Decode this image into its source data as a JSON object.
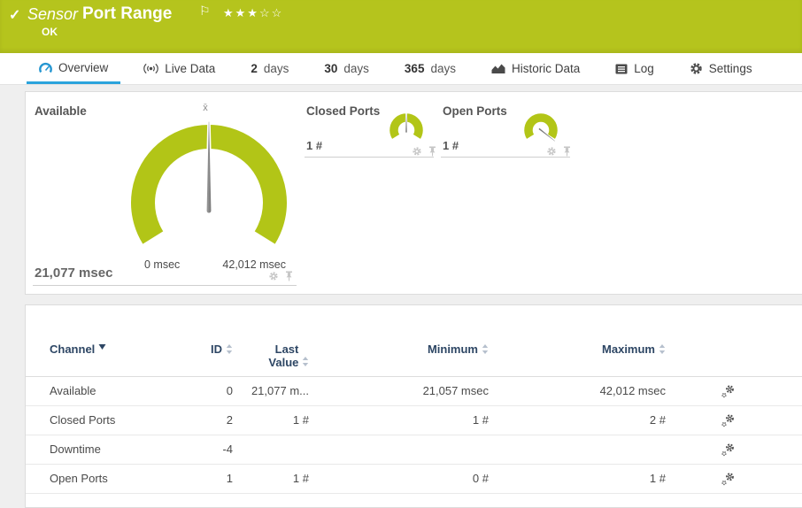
{
  "header": {
    "check_icon": "✓",
    "kind_label": "Sensor",
    "title": "Port Range",
    "flag_icon": "⚐",
    "stars_filled": "★★★",
    "stars_empty": "☆☆",
    "status": "OK"
  },
  "tabs": [
    {
      "label": "Overview",
      "icon": "gauge-icon",
      "active": true
    },
    {
      "label": "Live Data",
      "icon": "broadcast-icon",
      "active": false
    },
    {
      "num": "2",
      "label": "days",
      "active": false
    },
    {
      "num": "30",
      "label": "days",
      "active": false
    },
    {
      "num": "365",
      "label": "days",
      "active": false
    },
    {
      "label": "Historic Data",
      "icon": "area-chart-icon",
      "active": false
    },
    {
      "label": "Log",
      "icon": "log-icon",
      "active": false
    },
    {
      "label": "Settings",
      "icon": "gear-icon",
      "active": false
    }
  ],
  "gauges": {
    "available": {
      "title": "Available",
      "value": "21,077 msec",
      "scale_min": "0 msec",
      "scale_max": "42,012 msec",
      "mean_marker": "x̄"
    },
    "closed_ports": {
      "title": "Closed Ports",
      "value": "1 #"
    },
    "open_ports": {
      "title": "Open Ports",
      "value": "1 #"
    }
  },
  "table": {
    "headers": {
      "channel": "Channel",
      "id": "ID",
      "last_value": "Last Value",
      "minimum": "Minimum",
      "maximum": "Maximum"
    },
    "rows": [
      {
        "channel": "Available",
        "id": "0",
        "last": "21,077 m...",
        "min": "21,057 msec",
        "max": "42,012 msec"
      },
      {
        "channel": "Closed Ports",
        "id": "2",
        "last": "1 #",
        "min": "1 #",
        "max": "2 #"
      },
      {
        "channel": "Downtime",
        "id": "-4",
        "last": "",
        "min": "",
        "max": ""
      },
      {
        "channel": "Open Ports",
        "id": "1",
        "last": "1 #",
        "min": "0 #",
        "max": "1 #"
      }
    ]
  },
  "colors": {
    "brand_green": "#b5c41d",
    "accent_blue": "#2aa3dc",
    "table_header_navy": "#2d4664",
    "needle_gray": "#8a8a8a"
  }
}
